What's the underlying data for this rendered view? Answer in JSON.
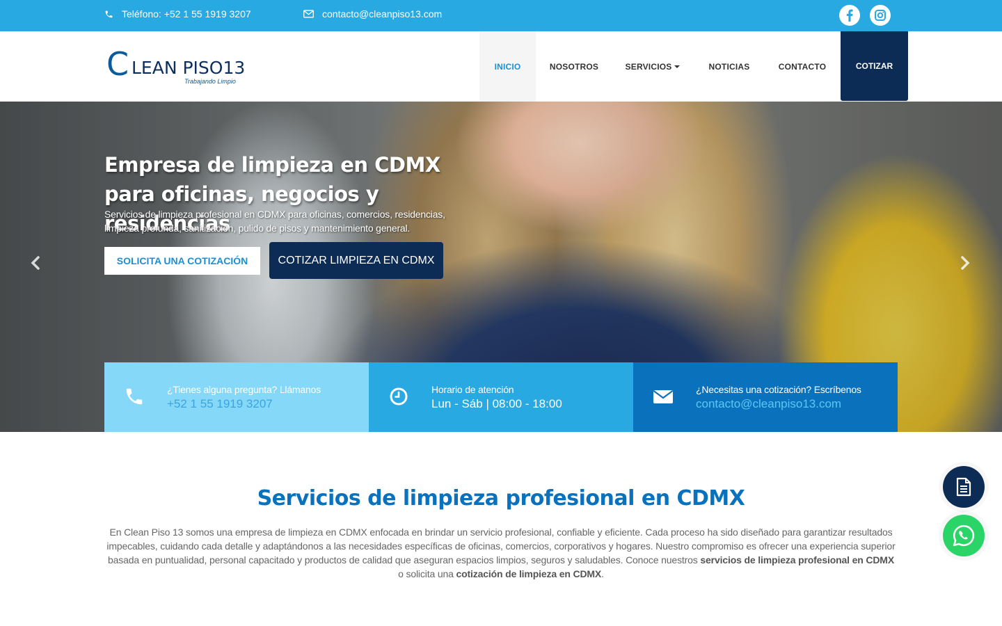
{
  "topbar": {
    "phone": "Teléfono: +52 1 55 1919 3207",
    "email": "contacto@cleanpiso13.com",
    "social": [
      "facebook-icon",
      "instagram-icon"
    ]
  },
  "brand": {
    "logo_letter": "C",
    "logo_word": "LEAN PISO13",
    "tagline": "Trabajando Limpio"
  },
  "nav": {
    "items": [
      {
        "label": "INICIO",
        "active": true
      },
      {
        "label": "NOSOTROS"
      },
      {
        "label": "SERVICIOS",
        "dropdown": true
      },
      {
        "label": "NOTICIAS"
      },
      {
        "label": "CONTACTO"
      }
    ],
    "cta": "COTIZAR"
  },
  "hero": {
    "title": "Empresa de limpieza en CDMX para oficinas, negocios y residencias",
    "subtitle": "Servicios de limpieza profesional en CDMX para oficinas, comercios, residencias, limpieza profunda, sanitización, pulido de pisos y mantenimiento general.",
    "btn_primary": "SOLICITA UNA COTIZACIÓN",
    "btn_secondary": "COTIZAR LIMPIEZA EN CDMX",
    "prev": "‹",
    "next": "›"
  },
  "info": [
    {
      "label": "¿Tienes alguna pregunta? Llámanos",
      "value": "+52 1 55 1919 3207",
      "icon": "phone-icon"
    },
    {
      "label": "Horario de atención",
      "value": "Lun - Sáb | 08:00 - 18:00",
      "icon": "clock-icon"
    },
    {
      "label": "¿Necesitas una cotización? Escríbenos",
      "value": "contacto@cleanpiso13.com",
      "icon": "envelope-icon"
    }
  ],
  "section": {
    "title": "Servicios de limpieza profesional en CDMX",
    "text_1": "En Clean Piso 13 somos una empresa de limpieza en CDMX enfocada en brindar un servicio profesional, confiable y eficiente. Cada proceso ha sido diseñado para garantizar resultados impecables, cuidando cada detalle y adaptándonos a las necesidades específicas de oficinas, comercios, corporativos y hogares. Nuestro compromiso es ofrecer una experiencia superior basada en puntualidad, personal capacitado y productos de calidad que aseguran espacios limpios, seguros y saludables. Conoce nuestros ",
    "bold_1": "servicios de limpieza profesional en CDMX",
    "text_2": " o solicita una ",
    "bold_2": "cotización de limpieza en CDMX",
    "text_3": "."
  },
  "colors": {
    "topbar": "#29a9e1",
    "navy": "#0c2b55",
    "accent": "#0a72bd",
    "whatsapp": "#2bd466"
  }
}
